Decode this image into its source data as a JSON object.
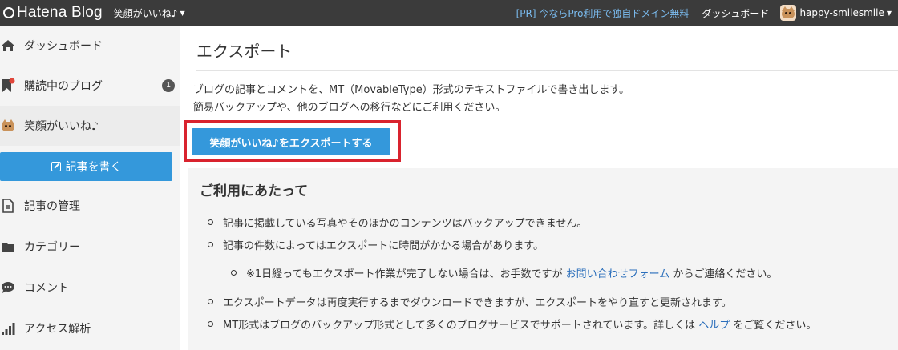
{
  "topbar": {
    "logo_text": "Hatena Blog",
    "blog_select": "笑顔がいいね♪",
    "promo": "[PR] 今ならPro利用で独自ドメイン無料",
    "dashboard": "ダッシュボード",
    "username": "happy-smilesmile"
  },
  "sidebar": {
    "dashboard": "ダッシュボード",
    "subscribed": "購読中のブログ",
    "subscribed_badge": "1",
    "blog_name": "笑顔がいいね♪",
    "write": "記事を書く",
    "manage": "記事の管理",
    "categories": "カテゴリー",
    "comments": "コメント",
    "analytics": "アクセス解析"
  },
  "main": {
    "title": "エクスポート",
    "desc_line1": "ブログの記事とコメントを、MT（MovableType）形式のテキストファイルで書き出します。",
    "desc_line2": "簡易バックアップや、他のブログへの移行などにご利用ください。",
    "export_button": "笑顔がいいね♪をエクスポートする",
    "notes_title": "ご利用にあたって",
    "note1": "記事に掲載している写真やそのほかのコンテンツはバックアップできません。",
    "note2": "記事の件数によってはエクスポートに時間がかかる場合があります。",
    "note3_pre": "※1日経ってもエクスポート作業が完了しない場合は、お手数ですが ",
    "note3_link": "お問い合わせフォーム",
    "note3_post": " からご連絡ください。",
    "note4": "エクスポートデータは再度実行するまでダウンロードできますが、エクスポートをやり直すと更新されます。",
    "note5_pre": "MT形式はブログのバックアップ形式として多くのブログサービスでサポートされています。詳しくは ",
    "note5_link": "ヘルプ",
    "note5_post": " をご覧ください。"
  },
  "colors": {
    "topbar": "#3b3b3b",
    "accent": "#3498db",
    "highlight": "#d9232e",
    "link": "#2a6ebb"
  }
}
